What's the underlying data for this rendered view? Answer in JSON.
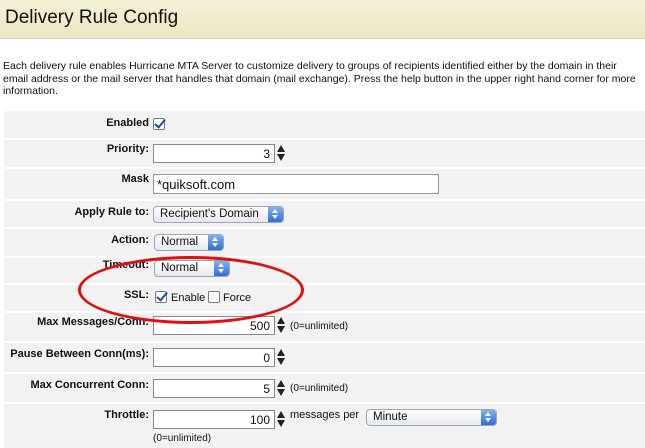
{
  "window": {
    "title": "Delivery Rule Config"
  },
  "description": "Each delivery rule enables Hurricane MTA Server to customize delivery to groups of recipients identified either by the domain in their email address or the mail server that handles that domain (mail exchange).  Press the help button in the upper right hand corner for more information.",
  "form": {
    "enabled": {
      "label": "Enabled",
      "checked": true
    },
    "priority": {
      "label": "Priority:",
      "value": "3"
    },
    "mask": {
      "label": "Mask",
      "value": "*quiksoft.com"
    },
    "apply_rule_to": {
      "label": "Apply Rule to:",
      "selected": "Recipient's Domain"
    },
    "action": {
      "label": "Action:",
      "selected": "Normal"
    },
    "timeout": {
      "label": "Timeout:",
      "selected": "Normal"
    },
    "ssl": {
      "label": "SSL:",
      "enable_label": "Enable",
      "enable_checked": true,
      "force_label": "Force",
      "force_checked": false
    },
    "max_messages": {
      "label": "Max Messages/Conn:",
      "value": "500",
      "hint": "(0=unlimited)"
    },
    "pause_between": {
      "label": "Pause Between Conn(ms):",
      "value": "0"
    },
    "max_concurrent": {
      "label": "Max Concurrent Conn:",
      "value": "5",
      "hint": "(0=unlimited)"
    },
    "throttle": {
      "label": "Throttle:",
      "value": "100",
      "unit_label": "messages per",
      "period_selected": "Minute",
      "hint": "(0=unlimited)"
    }
  },
  "annotation": {
    "color": "#e01010"
  },
  "colors": {
    "title_bg": "#f4f1d6",
    "row_bg": "#f2f2f2",
    "accent": "#2f6fd6"
  }
}
